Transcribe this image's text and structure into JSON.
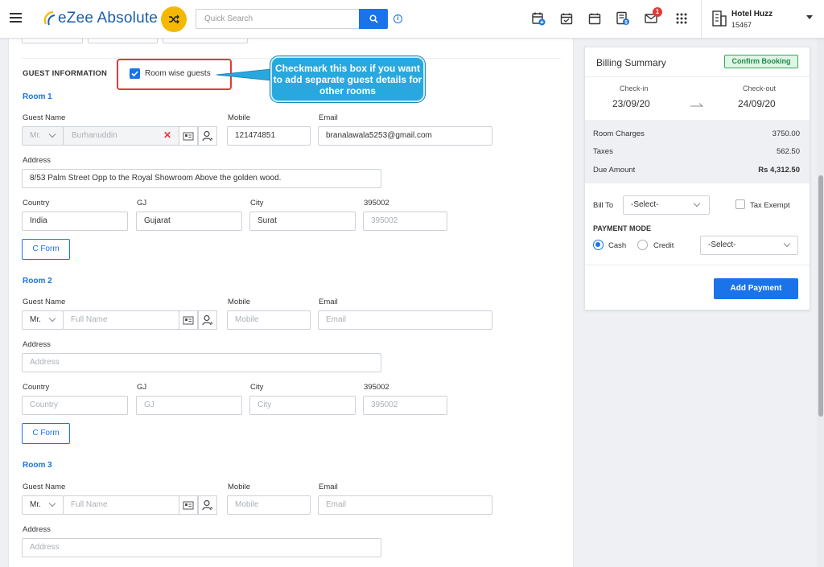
{
  "app": {
    "name": "eZee Absolute"
  },
  "search": {
    "placeholder": "Quick Search"
  },
  "hotel": {
    "name": "Hotel Huzz",
    "id": "15467"
  },
  "notifications": {
    "mail_count": "1"
  },
  "guest_info": {
    "title": "GUEST INFORMATION",
    "room_wise_label": "Room wise guests",
    "room_wise_checked": true,
    "callout": "Checkmark this box if you want to add separate guest details for other rooms"
  },
  "labels": {
    "guest_name": "Guest Name",
    "mobile": "Mobile",
    "email": "Email",
    "address": "Address",
    "country": "Country",
    "state": "GJ",
    "city": "City",
    "zip": "395002",
    "cform": "C Form"
  },
  "rooms": [
    {
      "title": "Room 1",
      "salutation": "Mr.",
      "name": "Burhanuddin",
      "mobile": "121474851",
      "email": "branalawala5253@gmail.com",
      "address": "8/53 Palm Street  Opp to the Royal Showroom  Above the golden wood.",
      "country": "India",
      "state": "Gujarat",
      "city": "Surat",
      "zip_placeholder": "395002"
    },
    {
      "title": "Room 2",
      "salutation": "Mr.",
      "name_placeholder": "Full Name",
      "mobile_placeholder": "Mobile",
      "email_placeholder": "Email",
      "address_placeholder": "Address",
      "country_placeholder": "Country",
      "state_placeholder": "GJ",
      "city_placeholder": "City",
      "zip_placeholder": "395002"
    },
    {
      "title": "Room 3",
      "salutation": "Mr.",
      "name_placeholder": "Full Name",
      "mobile_placeholder": "Mobile",
      "email_placeholder": "Email",
      "address_placeholder": "Address"
    }
  ],
  "billing": {
    "title": "Billing Summary",
    "status": "Confirm Booking",
    "checkin_label": "Check-in",
    "checkin": "23/09/20",
    "checkout_label": "Check-out",
    "checkout": "24/09/20",
    "charges": [
      {
        "label": "Room Charges",
        "value": "3750.00"
      },
      {
        "label": "Taxes",
        "value": "562.50"
      },
      {
        "label": "Due Amount",
        "value": "Rs 4,312.50"
      }
    ],
    "bill_to_label": "Bill To",
    "bill_to_value": "-Select-",
    "tax_exempt_label": "Tax Exempt",
    "tax_exempt_checked": false,
    "payment_mode_label": "PAYMENT MODE",
    "cash_label": "Cash",
    "credit_label": "Credit",
    "payment_select": "-Select-",
    "add_payment": "Add Payment"
  },
  "colors": {
    "accent": "#1a73e8",
    "brand": "#1a5ea8",
    "shuffle": "#f5b800",
    "callout": "#29a8df",
    "highlight": "#e53935",
    "confirm": "#37a55b"
  },
  "icons": [
    "menu-icon",
    "shuffle-icon",
    "search-icon",
    "info-icon",
    "add-booking-calendar-icon",
    "calendar-check-icon",
    "calendar-icon",
    "invoice-icon",
    "mail-icon",
    "apps-grid-icon",
    "hotel-building-icon",
    "id-card-icon",
    "user-add-icon",
    "clear-icon",
    "arrow-right-icon"
  ]
}
